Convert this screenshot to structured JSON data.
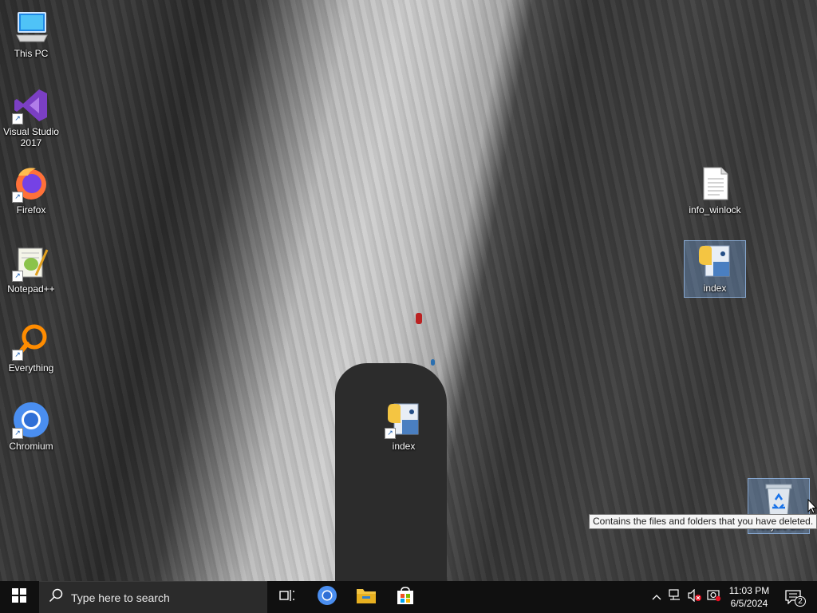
{
  "desktop": {
    "icons_left": [
      {
        "label": "This PC",
        "icon": "this-pc-icon"
      },
      {
        "label": "Visual Studio 2017",
        "icon": "visual-studio-icon"
      },
      {
        "label": "Firefox",
        "icon": "firefox-icon"
      },
      {
        "label": "Notepad++",
        "icon": "notepadpp-icon"
      },
      {
        "label": "Everything",
        "icon": "everything-icon"
      },
      {
        "label": "Chromium",
        "icon": "chromium-icon"
      }
    ],
    "index_shortcut": {
      "label": "index",
      "icon": "python-file-icon"
    },
    "info_winlock": {
      "label": "info_winlock",
      "icon": "text-file-icon"
    },
    "index_file": {
      "label": "index",
      "icon": "python-file-icon"
    },
    "recycle_bin": {
      "label": "Recycle Bin",
      "icon": "recycle-bin-icon"
    },
    "tooltip": "Contains the files and folders that you have deleted."
  },
  "taskbar": {
    "search_placeholder": "Type here to search",
    "apps": [
      "task-view-icon",
      "chromium-icon",
      "file-explorer-icon",
      "microsoft-store-icon"
    ],
    "tray": {
      "time": "11:03 PM",
      "date": "6/5/2024",
      "notification_count": "2"
    }
  },
  "colors": {
    "taskbar_bg": "#101010",
    "search_bg": "#2b2b2b",
    "accent_blue": "#1a73e8",
    "folder_yellow": "#f4c542"
  }
}
